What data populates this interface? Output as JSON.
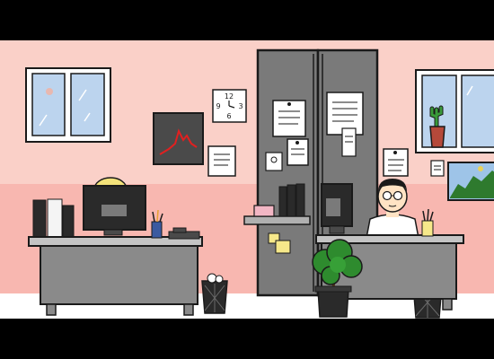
{
  "scene": {
    "kind": "cartoon office interior",
    "colors": {
      "wall_upper": "#fad0c8",
      "wall_lower": "#f8b7b0",
      "floor": "#ffffff",
      "outline": "#1a1a1a",
      "desk": "#8a8a8a",
      "desk_top": "#c4c4c4",
      "cabinet": "#7a7a7a",
      "chart_line": "#e02020",
      "window_sky": "#bcd4ee",
      "plant": "#2e8b2e",
      "skin": "#ffe3c4",
      "hair_blonde": "#f3e27a"
    }
  },
  "wall_clock": {
    "numerals": [
      "12",
      "3",
      "6",
      "9"
    ]
  },
  "icons": {
    "clock": "wall-clock-icon",
    "chart": "wall-chart-icon",
    "plant": "potted-plant-icon",
    "cactus": "cactus-icon",
    "bin": "wastebasket-icon"
  }
}
